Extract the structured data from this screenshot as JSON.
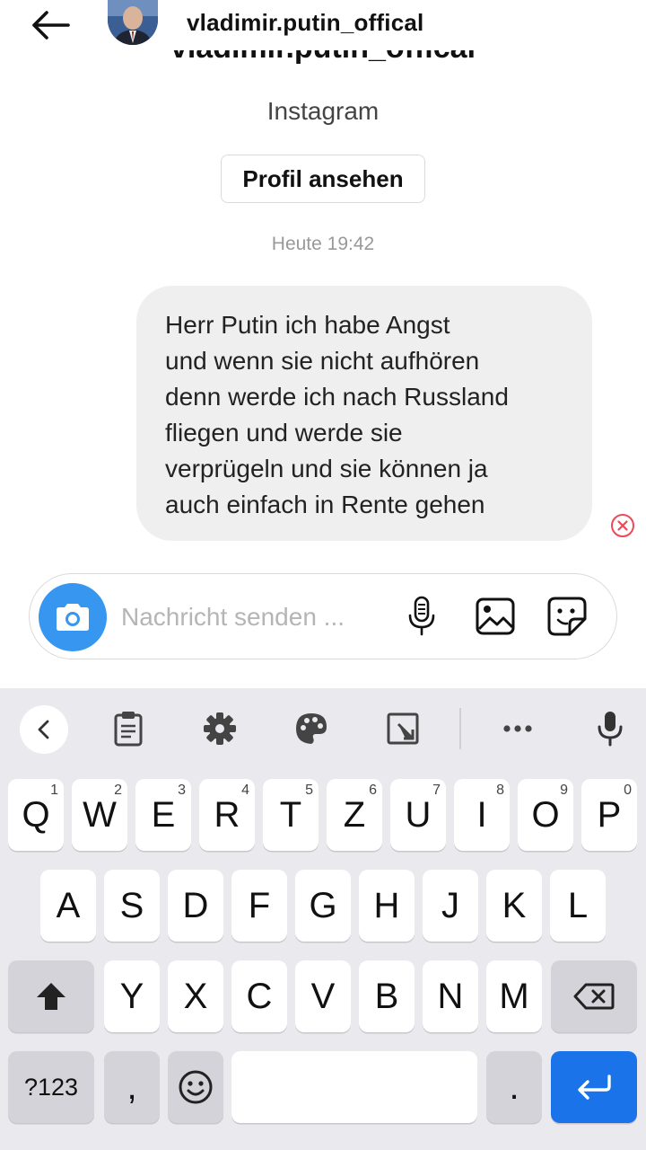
{
  "header": {
    "username": "vladimir.putin_offical"
  },
  "profile": {
    "name": "vladimir.putin_offical",
    "platform": "Instagram",
    "view_profile_label": "Profil ansehen"
  },
  "chat": {
    "timestamp": "Heute 19:42",
    "message_lines": [
      "Herr Putin ich habe Angst",
      "und wenn sie nicht aufhören",
      "denn werde ich nach Russland",
      "fliegen und werde sie",
      "verprügeln und sie können ja",
      "auch einfach in Rente gehen"
    ]
  },
  "composer": {
    "placeholder": "Nachricht senden ..."
  },
  "colors": {
    "accent_blue": "#3797f0",
    "bubble_gray": "#efefef",
    "error_red": "#ed4956",
    "keyboard_bg": "#e9e9ee",
    "enter_key_blue": "#1a73e8"
  },
  "keyboard": {
    "toolbar_icons": [
      "chevron-left-icon",
      "clipboard-icon",
      "settings-icon",
      "palette-icon",
      "resize-icon",
      "more-icon",
      "microphone-icon"
    ],
    "row1": [
      {
        "key": "Q",
        "num": "1"
      },
      {
        "key": "W",
        "num": "2"
      },
      {
        "key": "E",
        "num": "3"
      },
      {
        "key": "R",
        "num": "4"
      },
      {
        "key": "T",
        "num": "5"
      },
      {
        "key": "Z",
        "num": "6"
      },
      {
        "key": "U",
        "num": "7"
      },
      {
        "key": "I",
        "num": "8"
      },
      {
        "key": "O",
        "num": "9"
      },
      {
        "key": "P",
        "num": "0"
      }
    ],
    "row2": [
      "A",
      "S",
      "D",
      "F",
      "G",
      "H",
      "J",
      "K",
      "L"
    ],
    "row3": [
      "Y",
      "X",
      "C",
      "V",
      "B",
      "N",
      "M"
    ],
    "symbols_label": "?123",
    "comma_label": ",",
    "period_label": "."
  }
}
